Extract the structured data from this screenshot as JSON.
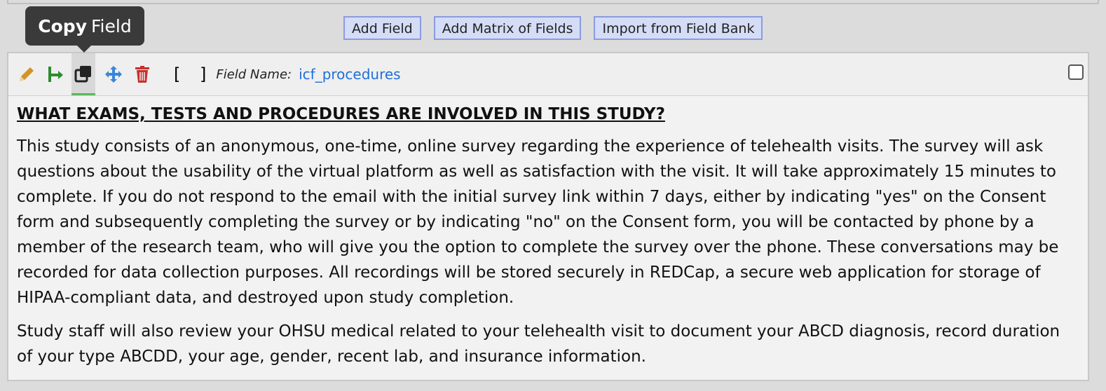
{
  "toolbar": {
    "add_field": "Add Field",
    "add_matrix": "Add Matrix of Fields",
    "import_bank": "Import from Field Bank"
  },
  "tooltip": {
    "bold": "Copy",
    "rest": "Field"
  },
  "field": {
    "brackets": "[ ]",
    "name_label": "Field Name:",
    "name_value": "icf_procedures",
    "heading": "WHAT EXAMS, TESTS AND PROCEDURES ARE INVOLVED IN THIS STUDY?",
    "paragraphs": [
      "This study consists of an anonymous, one-time, online survey regarding the experience of telehealth visits. The survey will ask questions about the usability of the virtual platform as well as satisfaction with the visit. It will take approximately 15 minutes to complete. If you do not respond to the email with the initial survey link within 7 days, either by indicating \"yes\" on the Consent form and subsequently completing the survey or by indicating \"no\" on the Consent form, you will be contacted by phone by a member of the research team, who will give you the option to complete the survey over the phone. These conversations may be recorded for data collection purposes. All recordings will be stored securely in REDCap, a secure web application for storage of HIPAA-compliant data, and destroyed upon study completion.",
      "Study staff will also review your OHSU medical related to your telehealth visit to document your ABCD diagnosis, record duration of your type  ABCDD, your age, gender, recent lab, and insurance information."
    ]
  },
  "icons": [
    "pencil-icon",
    "branch-icon",
    "copy-icon",
    "move-icon",
    "trash-icon"
  ],
  "colors": {
    "pencil": "#d4932a",
    "branch": "#2e8b2e",
    "move": "#3a86d8",
    "trash": "#c9302c",
    "link": "#1f6fd8"
  }
}
